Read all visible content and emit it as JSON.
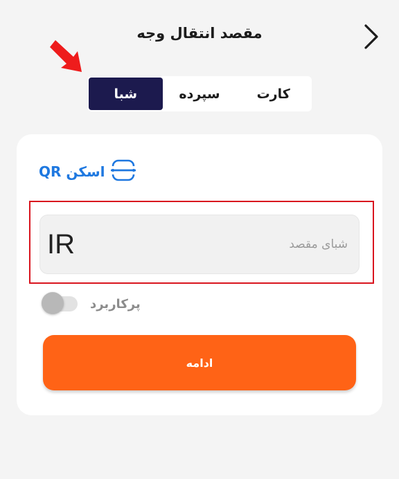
{
  "header": {
    "title": "مقصد انتقال وجه",
    "back_icon": "chevron-right-icon"
  },
  "annotation": {
    "arrow_icon": "red-arrow-icon",
    "arrow_color": "#ee1c1c",
    "highlight_color": "#d9141e"
  },
  "tabs": {
    "active": "sheba",
    "items": [
      {
        "id": "card",
        "label": "کارت"
      },
      {
        "id": "deposit",
        "label": "سپرده"
      },
      {
        "id": "sheba",
        "label": "شبا"
      }
    ]
  },
  "form": {
    "qr_scan": {
      "label": "اسکن QR",
      "icon": "qr-scan-icon"
    },
    "sheba_field": {
      "prefix": "IR",
      "placeholder": "شبای مقصد",
      "value": ""
    },
    "frequent_toggle": {
      "label": "پرکاربرد",
      "on": false
    },
    "continue_button": {
      "label": "ادامه"
    }
  },
  "colors": {
    "active_tab": "#1c1a4e",
    "accent_blue": "#1e78e0",
    "primary_button": "#ff6316"
  }
}
